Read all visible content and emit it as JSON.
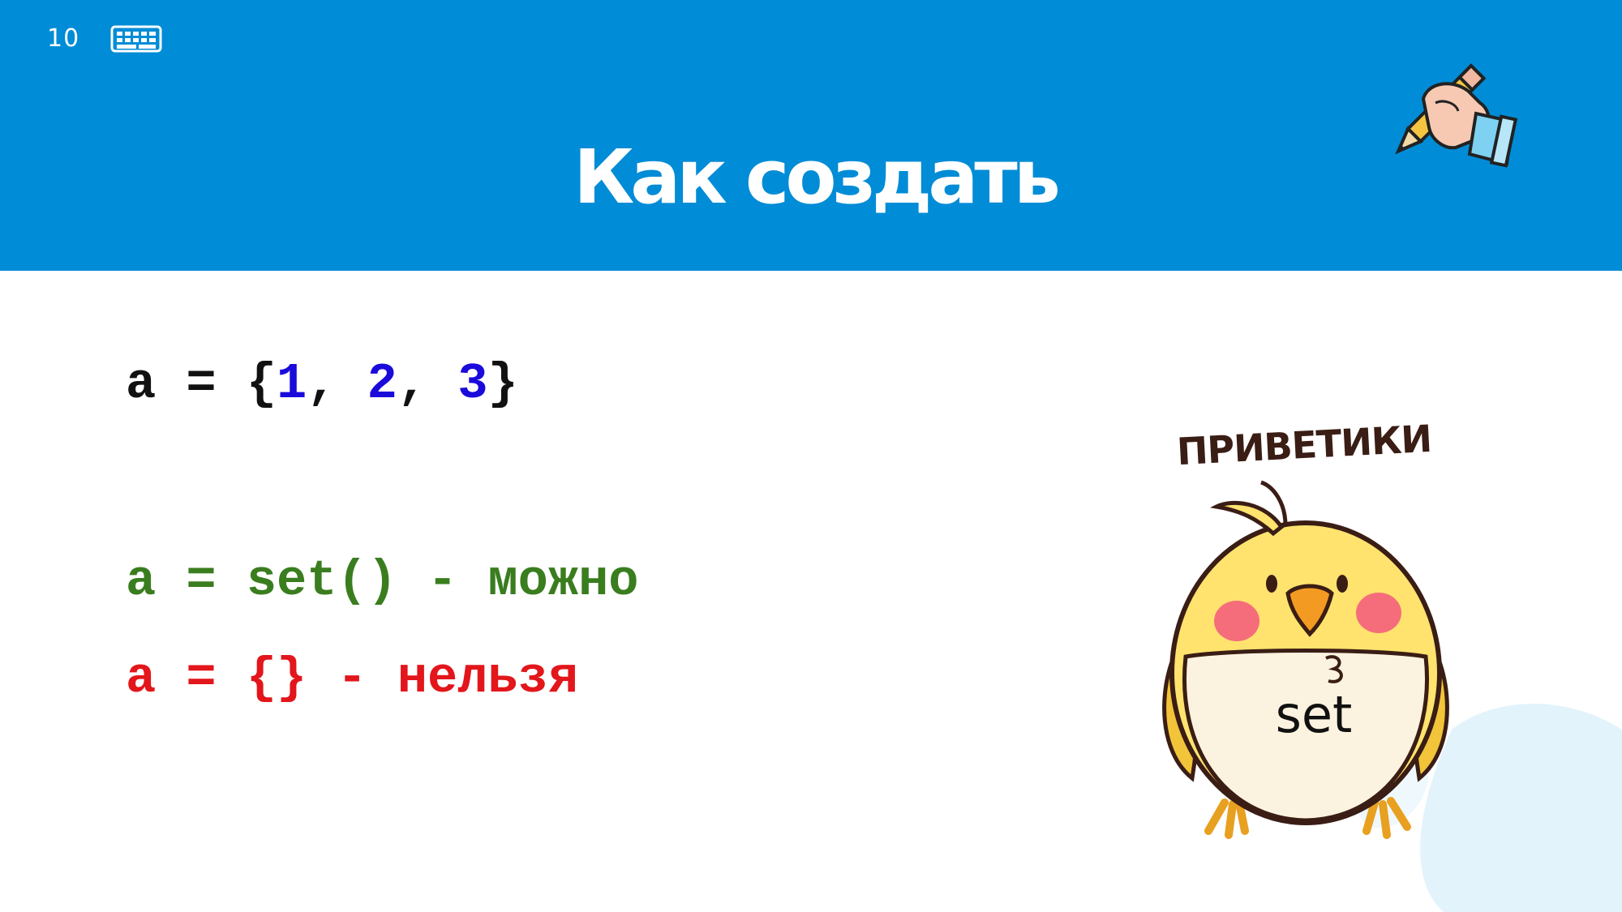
{
  "slide": {
    "number": "10",
    "title": "Как создать"
  },
  "code": {
    "line1": {
      "prefix": "a = {",
      "n1": "1",
      "sep1": ", ",
      "n2": "2",
      "sep2": ", ",
      "n3": "3",
      "suffix": "}"
    },
    "line2": "a = set() - можно",
    "line3": "a = {} - нельзя"
  },
  "illustration": {
    "greeting": "ПРИВЕТИКИ",
    "label": "set"
  },
  "colors": {
    "header": "#008cd6",
    "ok": "#3a7d1f",
    "bad": "#e2161b",
    "number": "#1a0adb"
  },
  "icons": [
    "keyboard-icon",
    "hand-pencil-icon",
    "bird-illustration"
  ]
}
